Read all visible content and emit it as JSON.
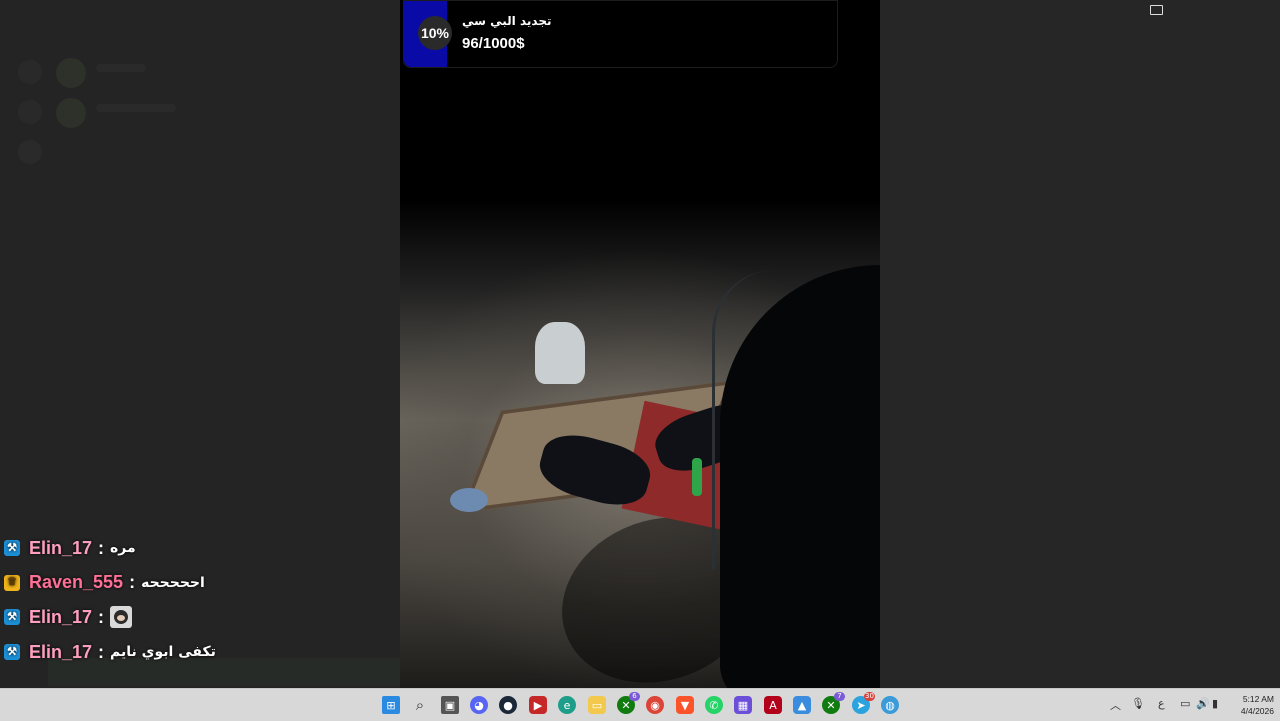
{
  "goal": {
    "percent_label": "10%",
    "progress": 0.1,
    "title": "تجديد البي سي",
    "amount": "96/1000$"
  },
  "chat": {
    "messages": [
      {
        "badge": "mod",
        "username": "Elin_17",
        "username_color": "#ff9fc0",
        "text": "مره"
      },
      {
        "badge": "vip",
        "username": "Raven_555",
        "username_color": "#ff6f96",
        "text": "احححححه"
      },
      {
        "badge": "mod",
        "username": "Elin_17",
        "username_color": "#ff9fc0",
        "text": "",
        "emote": "face-emote"
      },
      {
        "badge": "mod",
        "username": "Elin_17",
        "username_color": "#ff9fc0",
        "text": "تكفى ابوي نايم"
      }
    ],
    "separator": ":"
  },
  "taskbar": {
    "icons": [
      "windows-start-icon",
      "search-icon",
      "task-view-icon",
      "discord-icon",
      "steam-icon",
      "media-app-icon",
      "edge-icon",
      "file-explorer-icon",
      "xbox-icon",
      "chrome-icon",
      "brave-icon",
      "whatsapp-icon",
      "app-grid-icon",
      "adobe-icon",
      "photos-icon",
      "xbox-icon-2",
      "telegram-icon",
      "browser-icon"
    ],
    "badges": {
      "xbox": "6",
      "xbox2": "7",
      "telegram": "30"
    },
    "language": "ع",
    "time": "5:12 AM",
    "date": "4/4/2026"
  },
  "colors": {
    "mod_badge": "#1d8fd6",
    "vip_badge": "#f0b31b",
    "goal_fill": "#0a0aa6",
    "taskbar": "#d8d8d8"
  }
}
